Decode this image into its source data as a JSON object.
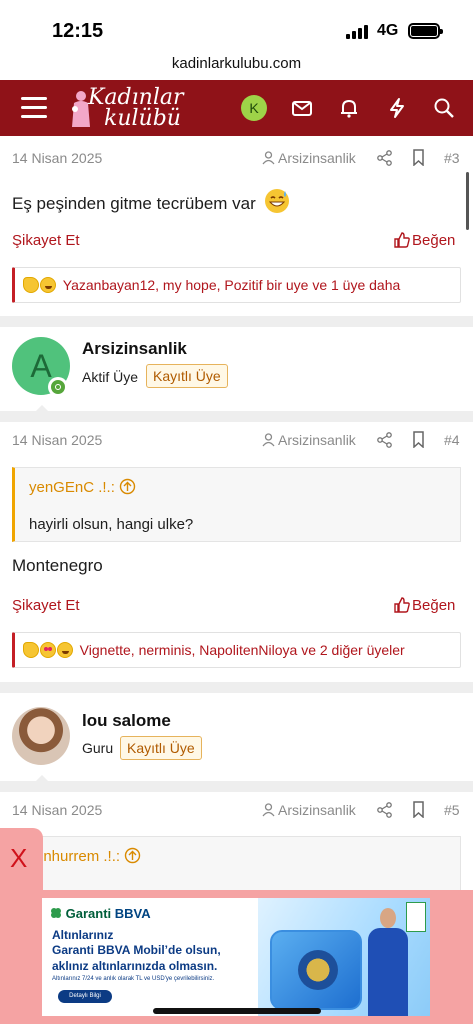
{
  "status_bar": {
    "time": "12:15",
    "network": "4G"
  },
  "browser": {
    "url": "kadinlarkulubu.com"
  },
  "header": {
    "logo_line1": "Kadınlar",
    "logo_line2": "kulübü",
    "avatar_letter": "K",
    "colors": {
      "bar": "#8f1218",
      "avatar": "#9ed348"
    }
  },
  "posts": [
    {
      "date": "14 Nisan 2025",
      "author": "Arsizinsanlik",
      "number": "#3",
      "text": "Eş peşinden gitme tecrübem var",
      "text_emoji": "grinning-sweat-emoji",
      "report_label": "Şikayet Et",
      "like_label": "Beğen",
      "reactions": "Yazanbayan12, my hope, Pozitif bir uye ve 1 üye daha"
    },
    {
      "date": "14 Nisan 2025",
      "author": "Arsizinsanlik",
      "number": "#4",
      "quote_author": "yenGEnC .!.:",
      "quote_text": "hayirli olsun, hangi ulke?",
      "text": "Montenegro",
      "report_label": "Şikayet Et",
      "like_label": "Beğen",
      "reactions": "Vignette, nerminis, NapolitenNiloya ve 2 diğer üyeler"
    },
    {
      "date": "14 Nisan 2025",
      "author": "Arsizinsanlik",
      "number": "#5",
      "quote_author": "enhurrem .!.:"
    }
  ],
  "users": [
    {
      "initial": "A",
      "name": "Arsizinsanlik",
      "title": "Aktif Üye",
      "badge": "Kayıtlı Üye"
    },
    {
      "name": "lou salome",
      "title": "Guru",
      "badge": "Kayıtlı Üye"
    }
  ],
  "ad": {
    "close_label": "X",
    "brand_a": "Garanti",
    "brand_b": "BBVA",
    "headline1": "Altınlarınız",
    "headline2": "Garanti BBVA Mobil’de olsun,",
    "headline3": "aklınız altınlarınızda olmasın.",
    "fine_print": "Altınlarınız 7/24 ve anlık olarak TL ve USD'ye çevrilebilirsiniz.",
    "cta": "Detaylı Bilgi"
  }
}
